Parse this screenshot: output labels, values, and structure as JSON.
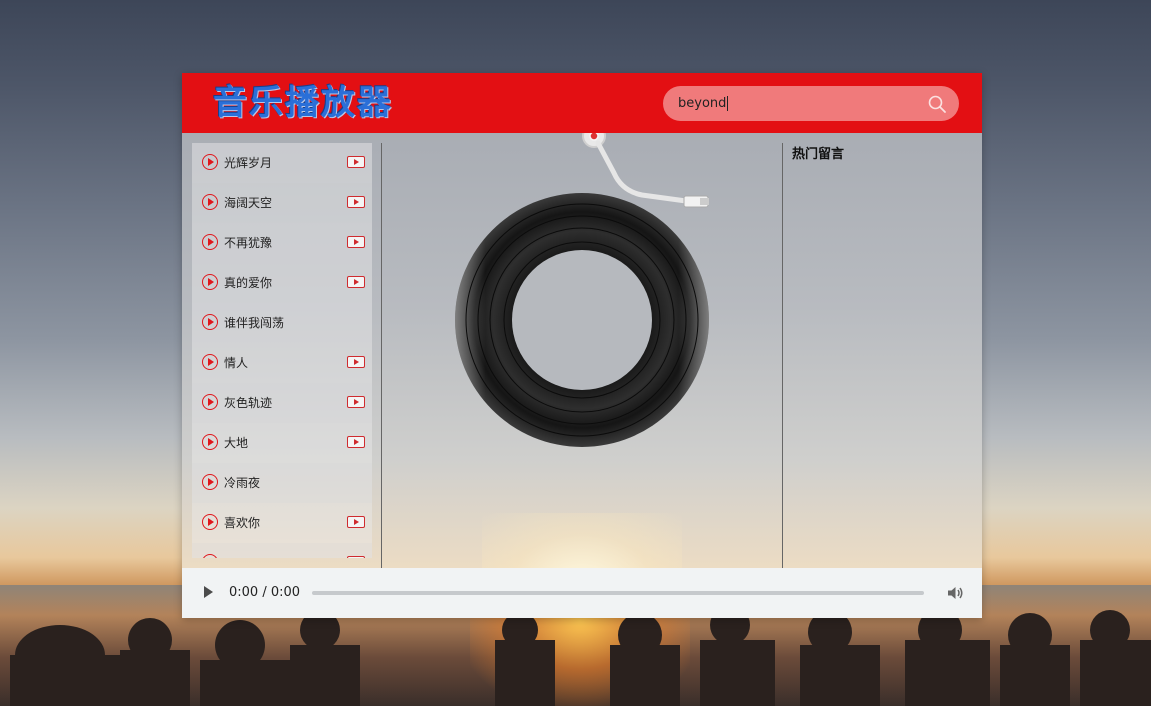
{
  "app": {
    "title": "音乐播放器"
  },
  "search": {
    "value": "beyond",
    "icon": "search-icon"
  },
  "songs": [
    {
      "name": "光辉岁月",
      "has_mv": true
    },
    {
      "name": "海阔天空",
      "has_mv": true
    },
    {
      "name": "不再犹豫",
      "has_mv": true
    },
    {
      "name": "真的爱你",
      "has_mv": true
    },
    {
      "name": "谁伴我闯荡",
      "has_mv": false
    },
    {
      "name": "情人",
      "has_mv": true
    },
    {
      "name": "灰色轨迹",
      "has_mv": true
    },
    {
      "name": "大地",
      "has_mv": true
    },
    {
      "name": "冷雨夜",
      "has_mv": false
    },
    {
      "name": "喜欢你",
      "has_mv": true
    }
  ],
  "comments": {
    "title": "热门留言"
  },
  "audio": {
    "time": "0:00 / 0:00",
    "progress": 0
  },
  "colors": {
    "header": "#e30f13",
    "search_bg": "#f07a7b",
    "accent": "#e0161b"
  }
}
